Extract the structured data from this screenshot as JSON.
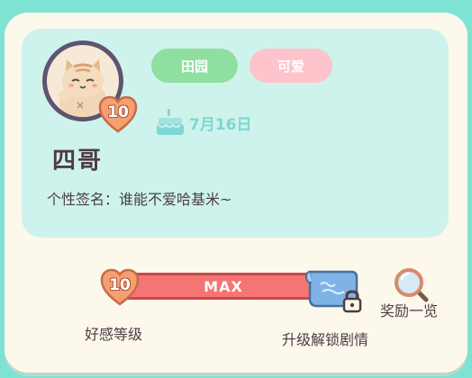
{
  "profile": {
    "name": "四哥",
    "signature": "个性签名：谁能不爱哈基米~",
    "affection_level": "10",
    "birthday": "7月16日",
    "tags": [
      "田园",
      "可爱"
    ]
  },
  "affection_bar": {
    "level_badge": "10",
    "status_text": "MAX",
    "progress": 1.0,
    "label": "好感等级",
    "unlock_label": "升级解锁剧情"
  },
  "rewards": {
    "label": "奖励一览"
  },
  "colors": {
    "background": "#7fe3d4",
    "panel": "#cdf3ec",
    "tag_garden": "#8fe0a0",
    "tag_cute": "#ffc3cc",
    "bar_fill": "#f57474",
    "text": "#4e3c44"
  }
}
